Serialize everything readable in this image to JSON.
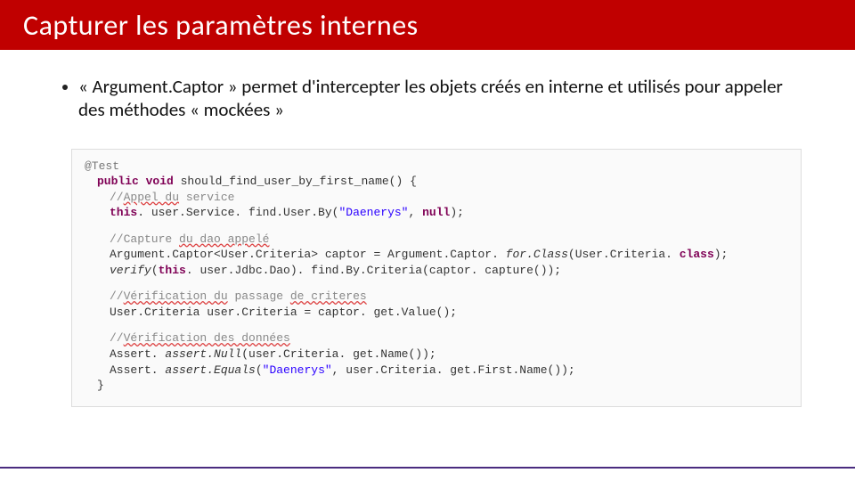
{
  "title": "Capturer les paramètres internes",
  "bullet": "« Argument.Captor » permet d'intercepter les objets créés en interne et utilisés pour appeler des méthodes « mockées »",
  "code": {
    "l1_anno": "@Test",
    "l2_kw1": "public void",
    "l2_rest": " should_find_user_by_first_name() {",
    "l3_cmt_prefix": "//",
    "l3_cmt_u": "Appel du",
    "l3_cmt_rest": " service",
    "l4_kw": "this",
    "l4_a": ". user.Service. find.User.By(",
    "l4_lit": "\"Daenerys\"",
    "l4_b": ", ",
    "l4_kw2": "null",
    "l4_c": ");",
    "l5_cmt_prefix": "//Capture ",
    "l5_cmt_u": "du dao appelé",
    "l6_a": "Argument.Captor<User.Criteria> captor = Argument.Captor. ",
    "l6_i": "for.Class",
    "l6_b": "(User.Criteria. ",
    "l6_kw": "class",
    "l6_c": ");",
    "l7_i": "verify",
    "l7_a": "(",
    "l7_kw": "this",
    "l7_b": ". user.Jdbc.Dao). find.By.Criteria(captor. capture());",
    "l8_cmt_prefix": "//",
    "l8_cmt_u": "Vérification du",
    "l8_cmt_rest": " passage ",
    "l8_cmt_u2": "de criteres",
    "l9": "User.Criteria user.Criteria = captor. get.Value();",
    "l10_cmt_prefix": "//",
    "l10_cmt_u": "Vérification des données",
    "l11_a": "Assert. ",
    "l11_i": "assert.Null",
    "l11_b": "(user.Criteria. get.Name());",
    "l12_a": "Assert. ",
    "l12_i": "assert.Equals",
    "l12_b": "(",
    "l12_lit": "\"Daenerys\"",
    "l12_c": ", user.Criteria. get.First.Name());",
    "l13": "}"
  }
}
